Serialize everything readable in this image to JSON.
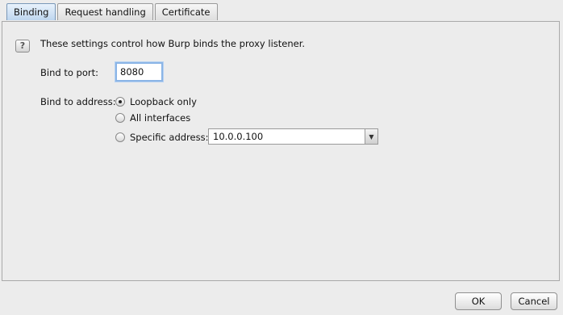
{
  "tabs": [
    {
      "label": "Binding"
    },
    {
      "label": "Request handling"
    },
    {
      "label": "Certificate"
    }
  ],
  "panel": {
    "help_icon_glyph": "?",
    "description": "These settings control how Burp binds the proxy listener.",
    "bind_port_label": "Bind to port:",
    "bind_port_value": "8080",
    "bind_address_label": "Bind to address:",
    "options": [
      {
        "label": "Loopback only",
        "selected": true
      },
      {
        "label": "All interfaces",
        "selected": false
      },
      {
        "label": "Specific address:",
        "selected": false
      }
    ],
    "specific_address_value": "10.0.0.100",
    "select_arrow_glyph": "▼"
  },
  "buttons": {
    "ok": "OK",
    "cancel": "Cancel"
  }
}
